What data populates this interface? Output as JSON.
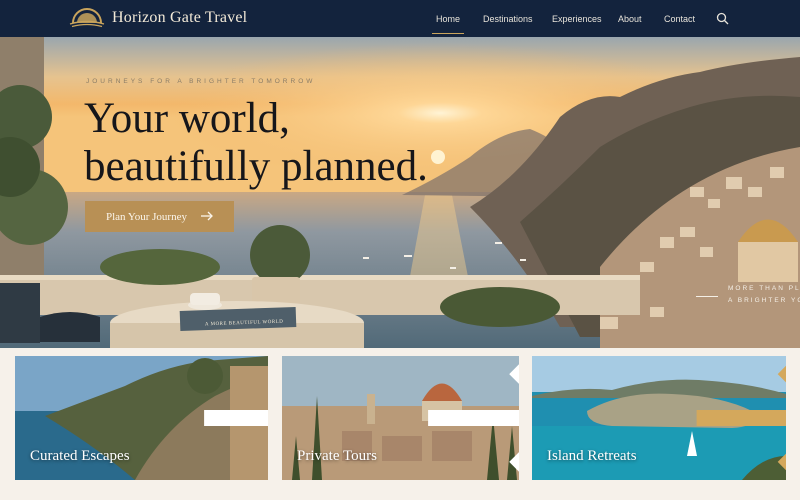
{
  "brand": {
    "name": "Horizon Gate Travel",
    "logo_icon": "sun-horizon-logo"
  },
  "nav": {
    "items": [
      {
        "label": "Home",
        "active": true
      },
      {
        "label": "Destinations",
        "active": false
      },
      {
        "label": "Experiences",
        "active": false
      },
      {
        "label": "About",
        "active": false
      },
      {
        "label": "Contact",
        "active": false
      }
    ],
    "search_icon": "search-icon"
  },
  "hero": {
    "tagline": "JOURNEYS FOR A BRIGHTER TOMORROW",
    "headline_line1": "Your world,",
    "headline_line2": "beautifully planned.",
    "cta_label": "Plan Your Journey",
    "side_note_line1": "MORE THAN PLA",
    "side_note_line2": "A BRIGHTER YO",
    "book_title": "A MORE BEAUTIFUL WORLD"
  },
  "cards": [
    {
      "label": "Curated Escapes"
    },
    {
      "label": "Private Tours"
    },
    {
      "label": "Island Retreats"
    }
  ],
  "colors": {
    "nav_bg": "#13233d",
    "accent_gold": "#b89055",
    "page_bg": "#f6f1ea",
    "headline": "#16161a"
  }
}
